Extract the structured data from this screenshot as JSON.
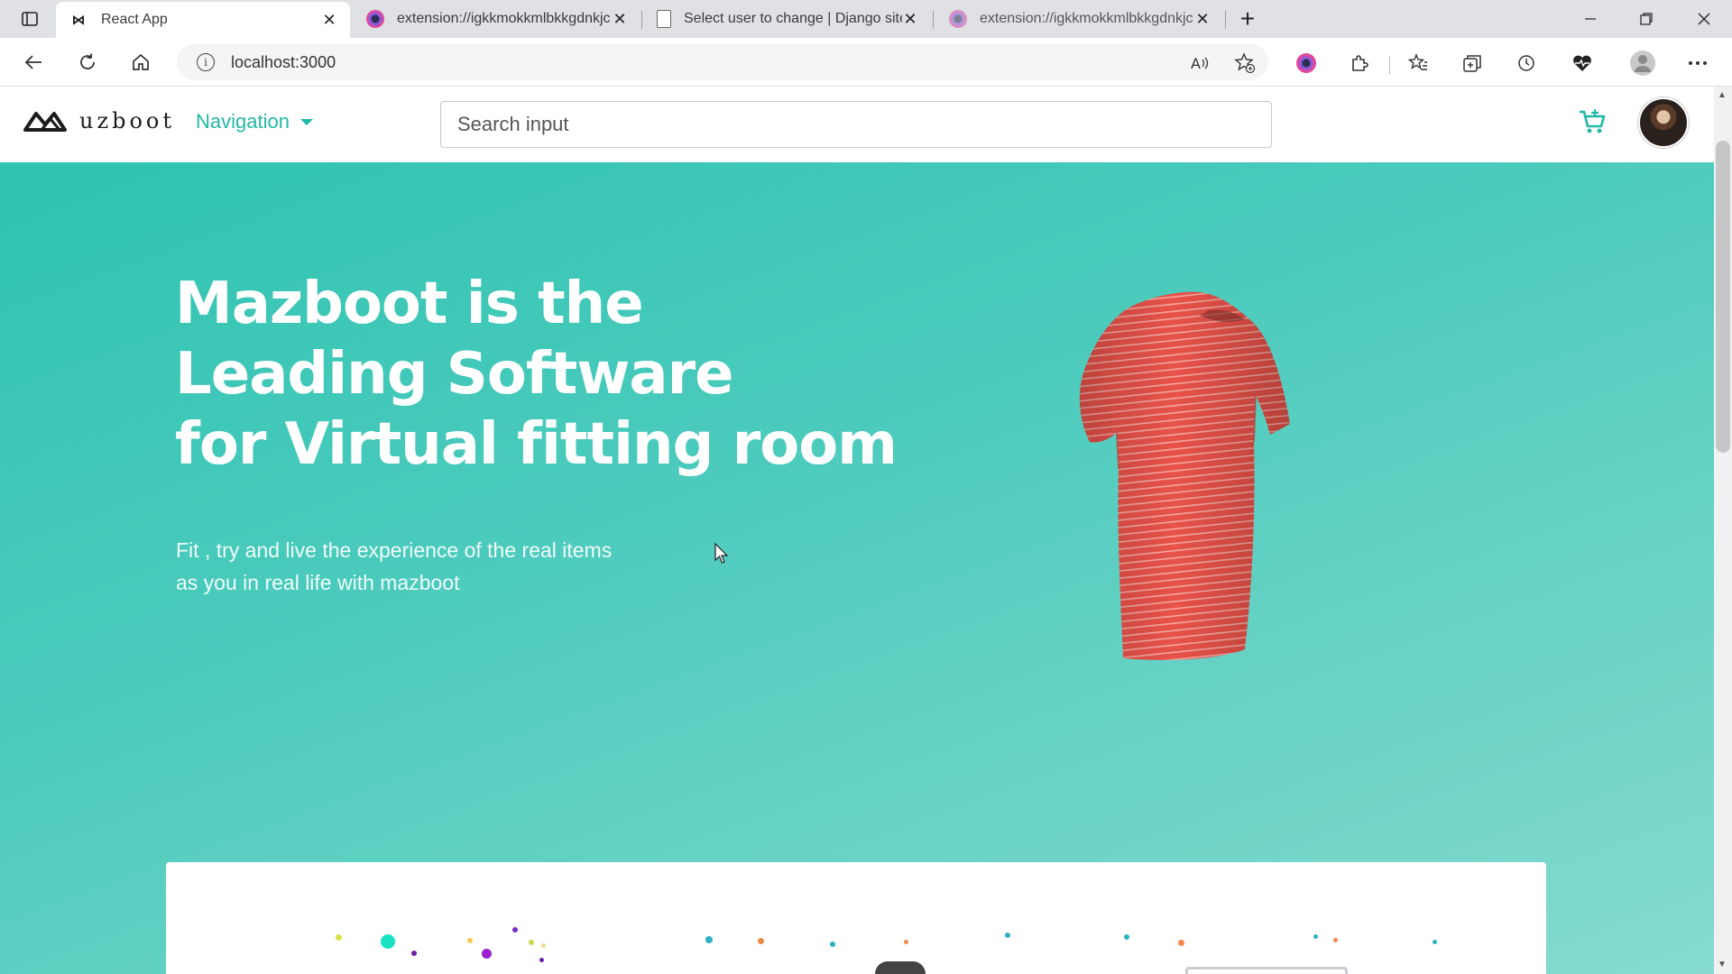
{
  "browser": {
    "tabs": [
      {
        "title": "React App",
        "icon": "react-logo-icon",
        "active": true
      },
      {
        "title": "extension://igkkmokkmlbkkgdnkjc",
        "icon": "extension-icon",
        "active": false
      },
      {
        "title": "Select user to change | Django site admin",
        "icon": "document-icon",
        "active": false
      },
      {
        "title": "extension://igkkmokkmlbkkgdnkjc",
        "icon": "extension-icon",
        "active": false
      }
    ],
    "url": "localhost:3000"
  },
  "header": {
    "logo_text": "uzboot",
    "nav_label": "Navigation",
    "search_placeholder": "Search input"
  },
  "hero": {
    "title_line1": "Mazboot is the",
    "title_line2": "Leading Software",
    "title_line3": "for Virtual fitting room",
    "subtitle_line1": "Fit , try and live the experience of the real items",
    "subtitle_line2": "as you in real life with mazboot"
  },
  "colors": {
    "accent": "#23b8a6",
    "hero_start": "#2fc3b0",
    "hero_end": "#86dacf",
    "shirt": "#e8524a"
  }
}
